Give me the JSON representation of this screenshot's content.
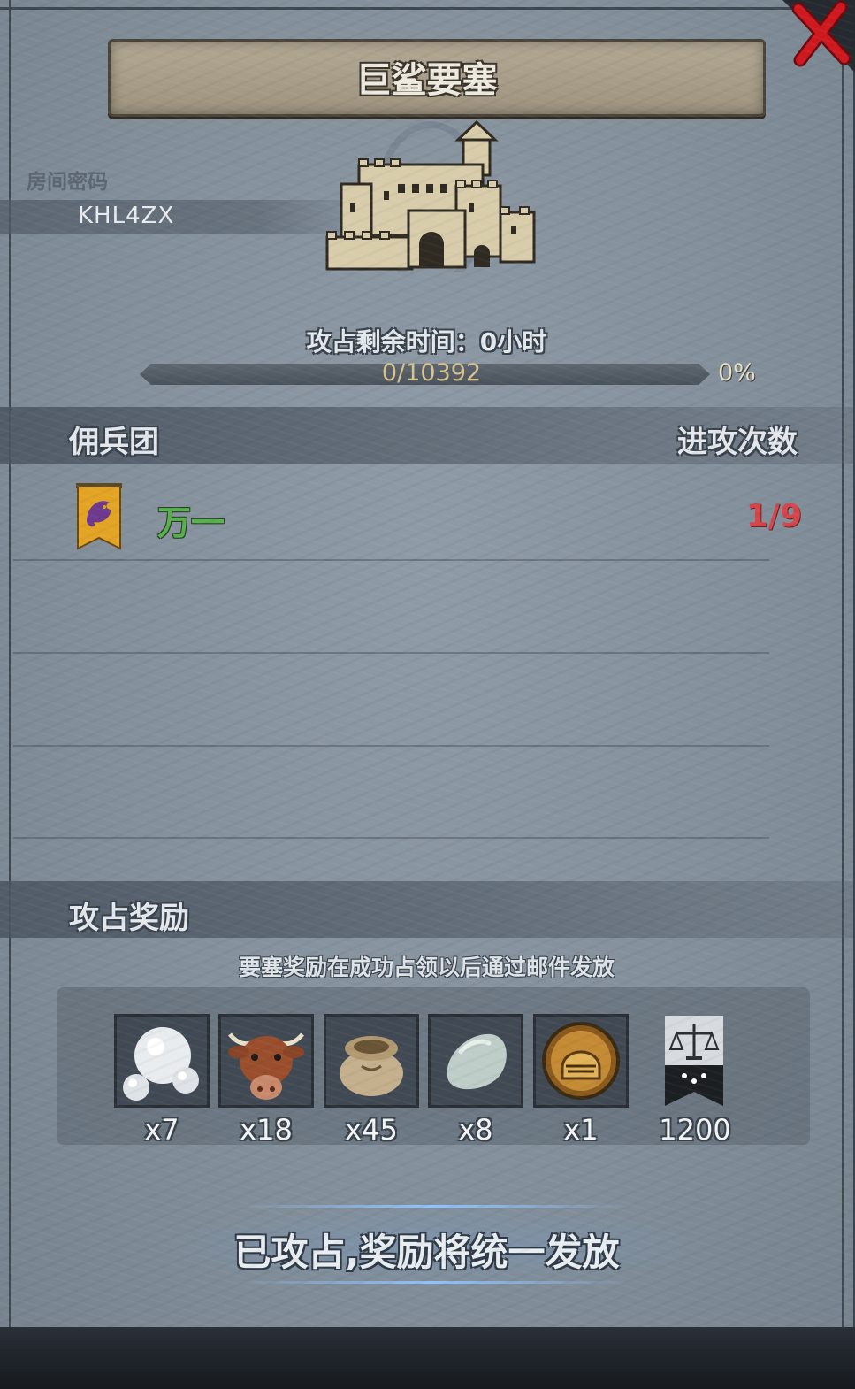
{
  "title": "巨鲨要塞",
  "room": {
    "label": "房间密码",
    "code": "KHL4ZX"
  },
  "siege": {
    "time_text": "攻占剩余时间：0小时",
    "progress_text": "0/10392",
    "progress_percent_text": "0%",
    "progress_fraction": 0
  },
  "mercenaries": {
    "header_left": "佣兵团",
    "header_right": "进攻次数",
    "rows": [
      {
        "name": "万一",
        "attacks": "1/9",
        "banner_icon": "purple-beast-banner-icon"
      }
    ]
  },
  "rewards": {
    "header": "攻占奖励",
    "note": "要塞奖励在成功占领以后通过邮件发放",
    "items": [
      {
        "icon": "pearl-icon",
        "qty": "x7"
      },
      {
        "icon": "ox-icon",
        "qty": "x18"
      },
      {
        "icon": "grain-sack-icon",
        "qty": "x45"
      },
      {
        "icon": "stone-icon",
        "qty": "x8"
      },
      {
        "icon": "gold-helmet-icon",
        "qty": "x1"
      },
      {
        "icon": "justice-banner-icon",
        "qty": "1200"
      }
    ]
  },
  "claim_button": "已攻占,奖励将统一发放",
  "colors": {
    "panel": "#838f9a",
    "title_scroll": "#a89e89",
    "merc_name": "#55b34a",
    "attack_count": "#d8454a",
    "close_red": "#c8161c",
    "progress_text": "#d8c48f"
  }
}
